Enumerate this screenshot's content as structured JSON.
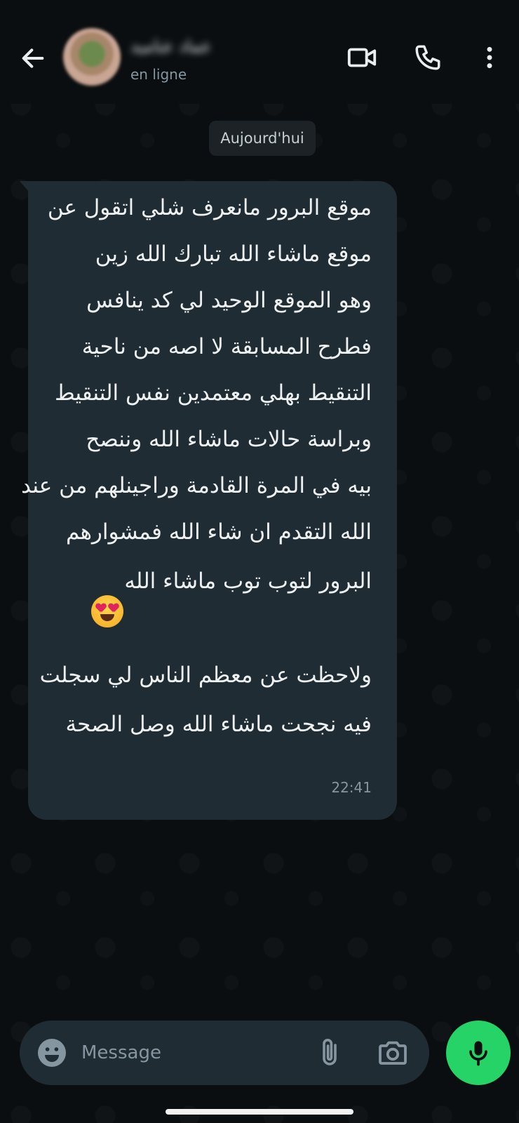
{
  "header": {
    "contact_name": "عماد عناميد",
    "status": "en ligne",
    "icons": [
      "back-arrow-icon",
      "video-call-icon",
      "phone-icon",
      "more-vert-icon"
    ]
  },
  "date_chip": "Aujourd'hui",
  "message": {
    "lines": [
      "موقع البرور مانعرف شلي اتقول عن",
      "موقع ماشاء الله تبارك الله زين",
      "وهو الموقع الوحيد لي كد ينافس",
      "فطرح المسابقة لا اصه من ناحية",
      "التنقيط بهلي معتمدين نفس التنقيط",
      "وبراسة حالات ماشاء الله وننصح",
      "بيه في المرة القادمة وراجينلهم من عند",
      "الله التقدم ان شاء الله فمشوارهم",
      "البرور لتوب توب ماشاء الله",
      "ولاحظت عن معظم الناس لي سجلت",
      "فيه نجحت ماشاء الله وصل الصحة"
    ],
    "emoji": "heart-eyes-emoji",
    "time": "22:41"
  },
  "composer": {
    "placeholder": "Message",
    "icons": [
      "emoji-icon",
      "attach-icon",
      "camera-icon",
      "mic-icon"
    ]
  },
  "colors": {
    "background": "#0b0e10",
    "bubble": "#202c33",
    "input": "#1f2c33",
    "accent": "#25d366",
    "muted": "#8696a0"
  }
}
